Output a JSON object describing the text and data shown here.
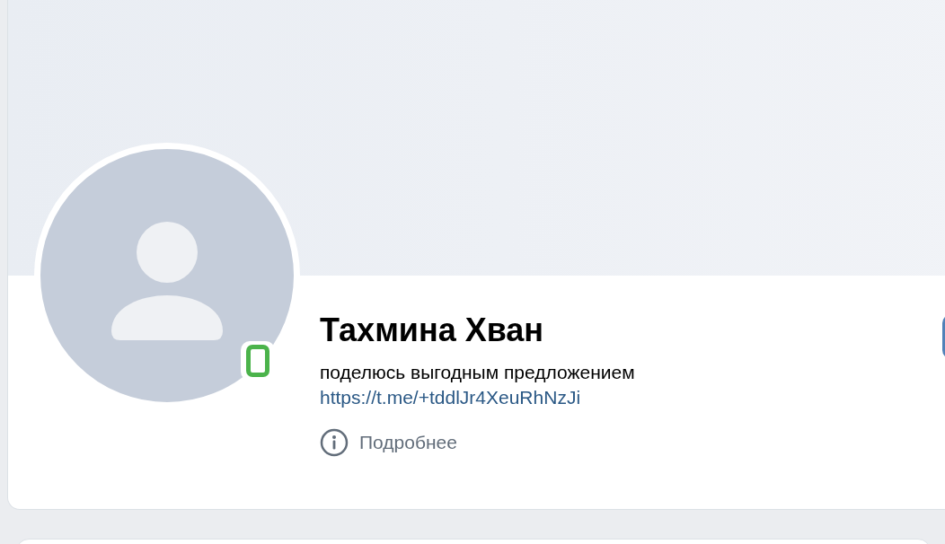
{
  "profile": {
    "name": "Тахмина Хван",
    "status": "поделюсь выгодным предложением",
    "link": "https://t.me/+tddlJr4XeuRhNzJi",
    "details": "Подробнее",
    "online": true
  }
}
